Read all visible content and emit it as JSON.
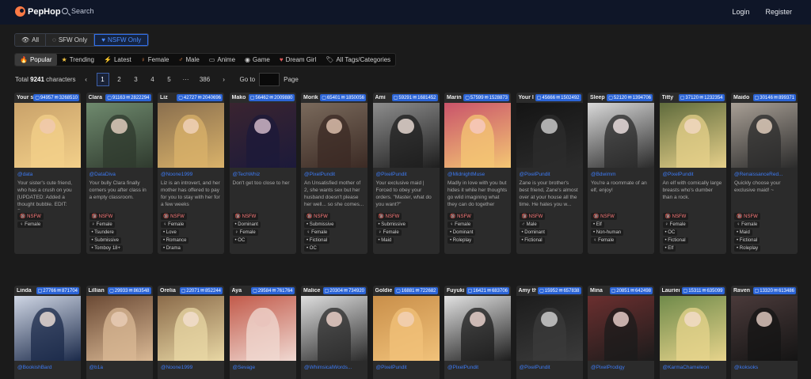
{
  "header": {
    "logo": "PepHop",
    "search_label": "Search",
    "login": "Login",
    "register": "Register"
  },
  "filters": [
    {
      "label": "All",
      "icon": "eye-icon",
      "active": false
    },
    {
      "label": "SFW Only",
      "icon": "eye-off-icon",
      "active": false
    },
    {
      "label": "NSFW Only",
      "icon": "heart-icon",
      "active": true
    }
  ],
  "categories": [
    {
      "label": "Popular",
      "icon": "flame-icon",
      "active": true
    },
    {
      "label": "Trending",
      "icon": "star-icon",
      "active": false
    },
    {
      "label": "Latest",
      "icon": "bolt-icon",
      "active": false
    },
    {
      "label": "Female",
      "icon": "female-icon",
      "active": false
    },
    {
      "label": "Male",
      "icon": "male-icon",
      "active": false
    },
    {
      "label": "Anime",
      "icon": "tv-icon",
      "active": false
    },
    {
      "label": "Game",
      "icon": "gamepad-icon",
      "active": false
    },
    {
      "label": "Dream Girl",
      "icon": "heart-icon",
      "active": false
    },
    {
      "label": "All Tags/Categories",
      "icon": "tags-icon",
      "active": false
    }
  ],
  "pagination": {
    "total_prefix": "Total",
    "total_count": "9241",
    "total_suffix": "characters",
    "prev": "‹",
    "pages": [
      "1",
      "2",
      "3",
      "4",
      "5"
    ],
    "ellipsis": "···",
    "last_page": "386",
    "next": "›",
    "goto_label": "Go to",
    "page_label": "Page"
  },
  "cards_row1": [
    {
      "name": "Your s",
      "chats": "94957",
      "msgs": "3268510",
      "creator": "@data",
      "desc": "Your sister's cute friend, who has a crush on you [UPDATED: Added a thought bubble. EDIT: Doesn...",
      "tags": [
        "NSFW",
        "Female"
      ],
      "colors": [
        "#c9a26a",
        "#f3d08a",
        "#f0c9b0"
      ]
    },
    {
      "name": "Clara",
      "chats": "91163",
      "msgs": "2822294",
      "creator": "@DataDiva",
      "desc": "Your bully Clara finally corners you after class in a empty classroom.",
      "tags": [
        "NSFW",
        "Female",
        "Tsundere",
        "Submissive",
        "Tomboy 18+"
      ],
      "colors": [
        "#6f8a6e",
        "#2f3a2e",
        "#e8d3c4"
      ]
    },
    {
      "name": "Liz",
      "chats": "42727",
      "msgs": "2040696",
      "creator": "@Noone1999",
      "desc": "Liz is an introvert, and her mother has offered to pay for you to stay with her for a few weeks",
      "tags": [
        "NSFW",
        "Female",
        "Love",
        "Romance",
        "Drama"
      ],
      "colors": [
        "#8a6f4e",
        "#d9b26a",
        "#f1d3bd"
      ]
    },
    {
      "name": "Mako",
      "chats": "56462",
      "msgs": "2009880",
      "creator": "@TechWhiz",
      "desc": "Don't get too close to her",
      "tags": [
        "NSFW",
        "Dominant",
        "Female",
        "OC"
      ],
      "colors": [
        "#3a2430",
        "#1c1a3a",
        "#d9c0d0"
      ]
    },
    {
      "name": "Morik",
      "chats": "65401",
      "msgs": "1850056",
      "creator": "@PixelPundit",
      "desc": "An Unsatisfied mother of 2, she wants sex but her husband doesn't please her well... so she comes...",
      "tags": [
        "NSFW",
        "Submissive",
        "Female",
        "Fictional",
        "OC"
      ],
      "colors": [
        "#7a6a5c",
        "#3b2a24",
        "#e3c5b3"
      ]
    },
    {
      "name": "Ami",
      "chats": "59291",
      "msgs": "1681452",
      "creator": "@PixelPundit",
      "desc": "Your exclusive maid | Forced to obey your orders. \"Master, what do you want?\"",
      "tags": [
        "NSFW",
        "Submissive",
        "Female",
        "Maid"
      ],
      "colors": [
        "#8d8d8d",
        "#1e1e1e",
        "#f0e1da"
      ]
    },
    {
      "name": "Marin",
      "chats": "57599",
      "msgs": "1528873",
      "creator": "@MidnightMuse",
      "desc": "Madly in love with you but hides it while her thoughts go wild imagining what they can do together",
      "tags": [
        "NSFW",
        "Female",
        "Dominant",
        "Roleplay"
      ],
      "colors": [
        "#c9536a",
        "#f4c774",
        "#f6c9c2"
      ]
    },
    {
      "name": "Your l",
      "chats": "45666",
      "msgs": "1502492",
      "creator": "@PixelPundit",
      "desc": "Zane is your brother's best friend, Zane's almost over at your house all the time. He hates you w...",
      "tags": [
        "NSFW",
        "Male",
        "Dominant",
        "Fictional"
      ],
      "colors": [
        "#141414",
        "#2c2c2c",
        "#cfcfcf"
      ]
    },
    {
      "name": "Sleep",
      "chats": "52120",
      "msgs": "1394706",
      "creator": "@Bdwimm",
      "desc": "You're a roommate of an elf, enjoy!",
      "tags": [
        "NSFW",
        "Elf",
        "Non-human",
        "Female"
      ],
      "colors": [
        "#d9d9d9",
        "#2a2a2a",
        "#f3e6e6"
      ]
    },
    {
      "name": "Titty",
      "chats": "37120",
      "msgs": "1232354",
      "creator": "@PixelPundit",
      "desc": "An elf with comically large breasts who's dumber than a rock.",
      "tags": [
        "NSFW",
        "Female",
        "OC",
        "Fictional",
        "Elf"
      ],
      "colors": [
        "#5f6b3c",
        "#e6d08a",
        "#f2d8c4"
      ]
    },
    {
      "name": "Maido",
      "chats": "30146",
      "msgs": "899371",
      "creator": "@RenaissanceRed...",
      "desc": "Quickly choose your exclusive maid! ~",
      "tags": [
        "NSFW",
        "Female",
        "Maid",
        "Fictional",
        "Roleplay"
      ],
      "colors": [
        "#a89f95",
        "#2b2b2b",
        "#e9d4c3"
      ]
    }
  ],
  "cards_row2": [
    {
      "name": "Linda",
      "chats": "27766",
      "msgs": "871704",
      "creator": "@BookishBard",
      "colors": [
        "#cfd6e4",
        "#1b2a4a",
        "#f1e2da"
      ]
    },
    {
      "name": "Lillian",
      "chats": "29933",
      "msgs": "863548",
      "creator": "@b1a",
      "colors": [
        "#6b4a35",
        "#d9b894",
        "#e9cdb6"
      ]
    },
    {
      "name": "Orelia",
      "chats": "22071",
      "msgs": "852244",
      "creator": "@Noone1999",
      "colors": [
        "#8b6b4a",
        "#e8d7a4",
        "#f3dfcf"
      ]
    },
    {
      "name": "Aya",
      "chats": "29584",
      "msgs": "761764",
      "creator": "@Sevage",
      "colors": [
        "#c25a4a",
        "#f0d9d2",
        "#e9c3bb"
      ]
    },
    {
      "name": "Malice",
      "chats": "20304",
      "msgs": "734920",
      "creator": "@WhimsicalWords...",
      "colors": [
        "#dedede",
        "#2b2b2b",
        "#f4d8d0"
      ]
    },
    {
      "name": "Goldie",
      "chats": "16881",
      "msgs": "722682",
      "creator": "@PixelPundit",
      "colors": [
        "#c98f4a",
        "#f1c27a",
        "#f3d2b9"
      ]
    },
    {
      "name": "Fuyuki",
      "chats": "16421",
      "msgs": "683706",
      "creator": "@PixelPundit",
      "colors": [
        "#e2e2e2",
        "#1d1d1d",
        "#f1dad3"
      ]
    },
    {
      "name": "Amy th",
      "chats": "15952",
      "msgs": "657838",
      "creator": "@PixelPundit",
      "colors": [
        "#1c1c1c",
        "#3b3b3b",
        "#d6d6d6"
      ]
    },
    {
      "name": "Mina",
      "chats": "20851",
      "msgs": "642498",
      "creator": "@PixelProdigy",
      "colors": [
        "#6b2f2f",
        "#1b1b1b",
        "#efd5cf"
      ]
    },
    {
      "name": "Laurien",
      "chats": "15311",
      "msgs": "635099",
      "creator": "@KarmaChameleon",
      "colors": [
        "#6f8a4a",
        "#e7d48c",
        "#f2dccb"
      ]
    },
    {
      "name": "Raven",
      "chats": "13320",
      "msgs": "613486",
      "creator": "@koksoks",
      "colors": [
        "#4a3a3a",
        "#141414",
        "#e7d0c6"
      ]
    }
  ],
  "tag_icons": {
    "NSFW": "🔞",
    "Female": "♀",
    "Male": "♂"
  }
}
